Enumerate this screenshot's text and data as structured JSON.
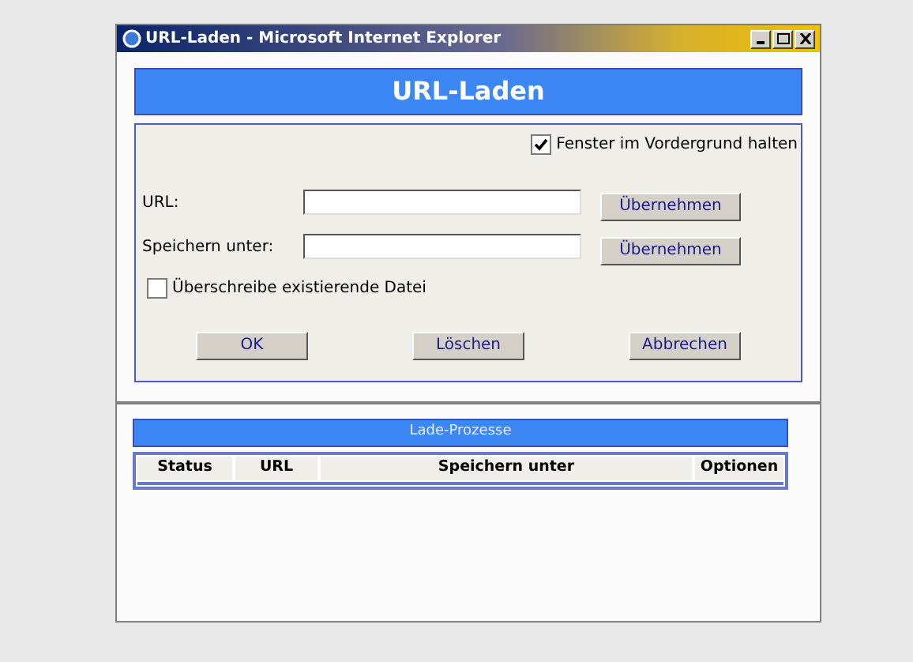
{
  "window": {
    "title": "URL-Laden - Microsoft Internet Explorer"
  },
  "header": {
    "title": "URL-Laden"
  },
  "form": {
    "keep_on_top": {
      "label": "Fenster im Vordergrund halten",
      "checked": true
    },
    "fields": [
      {
        "label": "URL:",
        "button": "Übernehmen"
      },
      {
        "label": "Speichern unter:",
        "button": "Übernehmen"
      }
    ],
    "overwrite": {
      "label": "Überschreibe existierende Datei",
      "checked": false
    },
    "buttons": [
      "OK",
      "Löschen",
      "Abbrechen"
    ]
  },
  "processes": {
    "title": "Lade-Prozesse",
    "columns": [
      "Status",
      "URL",
      "Speichern unter",
      "Optionen"
    ]
  }
}
